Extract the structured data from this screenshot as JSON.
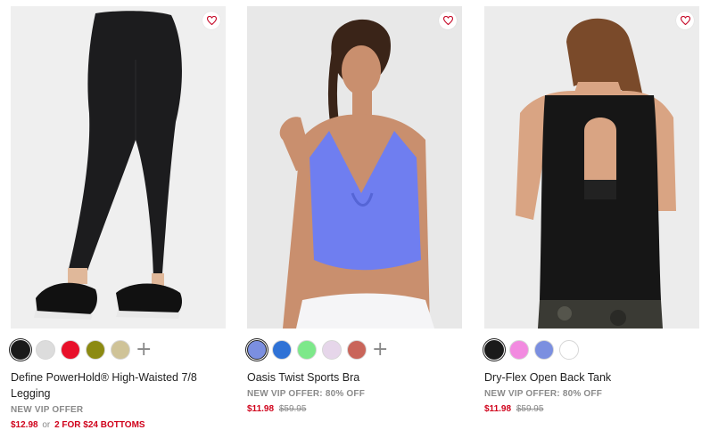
{
  "products": [
    {
      "name": "Define PowerHold® High-Waisted 7/8 Legging",
      "offer": "NEW VIP OFFER",
      "price": "$12.98",
      "or": "or",
      "promo": "2 FOR $24 BOTTOMS",
      "swatches": [
        "#1a1a1a",
        "#dcdcdc",
        "#e8102a",
        "#8c8a12",
        "#cfc398"
      ],
      "more": "+"
    },
    {
      "name": "Oasis Twist Sports Bra",
      "offer": "NEW VIP OFFER: 80% OFF",
      "price": "$11.98",
      "original_price": "$59.95",
      "swatches": [
        "#7b8fe0",
        "#2f72d6",
        "#7de88a",
        "#e6d6ea",
        "#c9655a"
      ],
      "more": "+"
    },
    {
      "name": "Dry-Flex Open Back Tank",
      "offer": "NEW VIP OFFER: 80% OFF",
      "price": "$11.98",
      "original_price": "$59.95",
      "swatches": [
        "#1a1a1a",
        "#f28be0",
        "#7b8fe0",
        "#ffffff"
      ]
    }
  ],
  "colors": {
    "price_red": "#d0021b",
    "muted": "#8a8a8a",
    "heart": "#c8102e"
  }
}
